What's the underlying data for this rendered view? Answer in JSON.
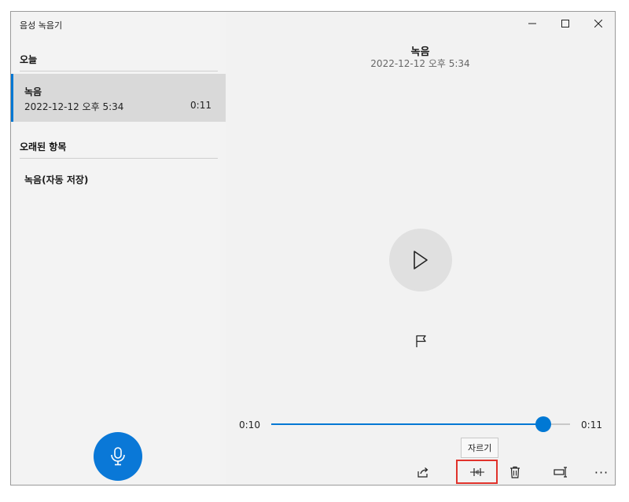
{
  "window": {
    "app_title": "음성 녹음기"
  },
  "sidebar": {
    "groups": [
      {
        "header": "오늘",
        "items": [
          {
            "name": "녹음",
            "date": "2022-12-12 오후 5:34",
            "duration": "0:11",
            "selected": true
          }
        ]
      },
      {
        "header": "오래된 항목",
        "items": [
          {
            "name": "녹음(자동 저장)"
          }
        ]
      }
    ],
    "record_button_icon": "microphone-icon"
  },
  "player": {
    "title": "녹음",
    "date": "2022-12-12 오후 5:34",
    "current_time": "0:10",
    "total_time": "0:11",
    "progress": 0.91,
    "play_icon": "play-icon",
    "marker_icon": "flag-icon"
  },
  "commands": {
    "tooltip": "자르기",
    "items": [
      "share-icon",
      "trim-icon",
      "delete-icon",
      "rename-icon",
      "more-icon"
    ],
    "more_label": "···"
  },
  "colors": {
    "accent": "#0078d4",
    "highlight_box": "#e0322b",
    "selected_bg": "#d9d9d9"
  }
}
